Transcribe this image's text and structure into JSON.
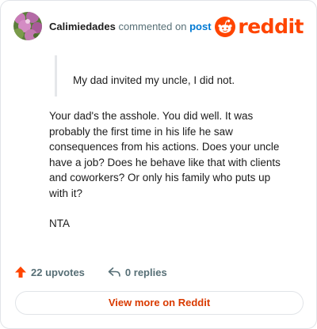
{
  "header": {
    "username": "Calimiedades",
    "action_text": "commented on",
    "target_link": "post",
    "logo_text": "reddit",
    "avatar_icon": "flower-avatar",
    "logo_icon": "reddit-snoo-icon"
  },
  "comment": {
    "quote": "My dad invited my uncle, I did not.",
    "paragraphs": [
      "Your dad's the asshole. You did well. It was probably the first time in his life he saw consequences from his actions. Does your uncle have a job? Does he behave like that with clients and coworkers? Or only his family who puts up with it?",
      "NTA"
    ]
  },
  "actions": {
    "upvotes_label": "22 upvotes",
    "replies_label": "0 replies",
    "upvote_icon": "upvote-arrow-icon",
    "reply_icon": "reply-arrow-icon"
  },
  "footer": {
    "view_more_label": "View more on Reddit"
  },
  "colors": {
    "brand": "#ff4500",
    "link": "#0079d3",
    "muted": "#576f76",
    "view_more": "#d93a00"
  }
}
